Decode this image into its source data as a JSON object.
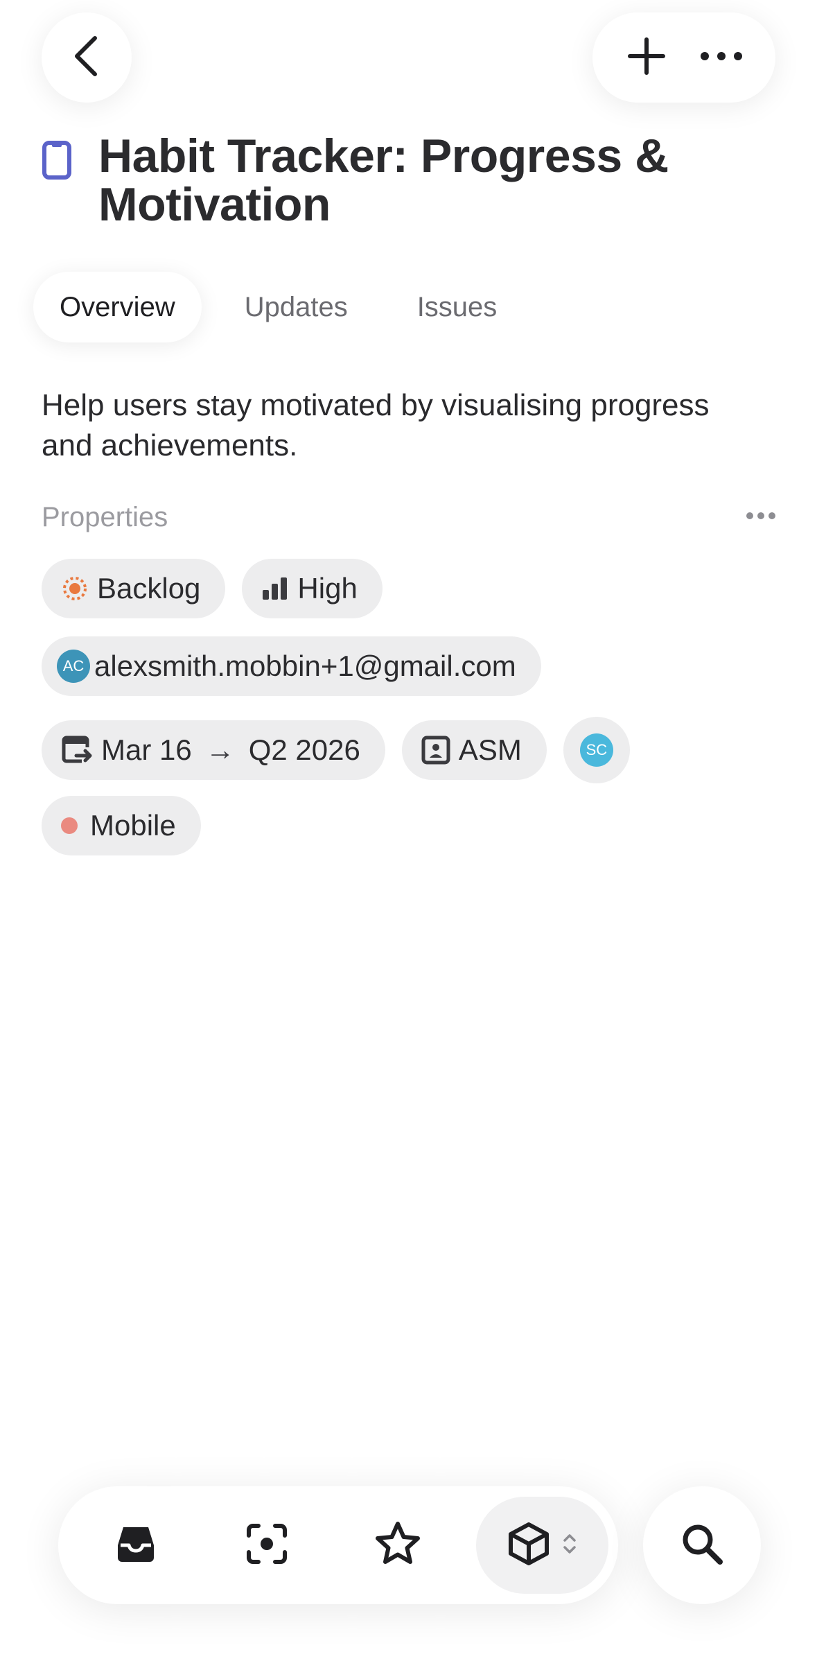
{
  "header": {
    "back_icon": "chevron-left-icon",
    "add_icon": "plus-icon",
    "more_icon": "ellipsis-icon"
  },
  "project": {
    "title": "Habit Tracker: Progress & Motivation",
    "icon": "mobile-device-icon",
    "icon_color": "#5b63c9",
    "description": "Help users stay motivated by visualising progress and achievements."
  },
  "tabs": [
    {
      "label": "Overview",
      "active": true
    },
    {
      "label": "Updates",
      "active": false
    },
    {
      "label": "Issues",
      "active": false
    }
  ],
  "properties": {
    "label": "Properties",
    "status": {
      "label": "Backlog",
      "icon": "backlog-status-icon",
      "color": "#e9793f"
    },
    "priority": {
      "label": "High",
      "icon": "priority-bars-icon"
    },
    "lead": {
      "initials": "AC",
      "email": "alexsmith.mobbin+1@gmail.com",
      "avatar_color": "#3d94b8"
    },
    "dates": {
      "start": "Mar 16",
      "arrow": "→",
      "end": "Q2 2026",
      "icon": "calendar-arrow-icon"
    },
    "team": {
      "label": "ASM",
      "icon": "team-badge-icon"
    },
    "member": {
      "initials": "SC",
      "avatar_color": "#4ab8dc"
    },
    "label_tag": {
      "label": "Mobile",
      "color": "#ea8a80"
    }
  },
  "bottom_nav": {
    "items": [
      "inbox-icon",
      "focus-scan-icon",
      "star-icon",
      "cube-icon"
    ],
    "active": "cube-icon",
    "search_icon": "search-icon"
  }
}
